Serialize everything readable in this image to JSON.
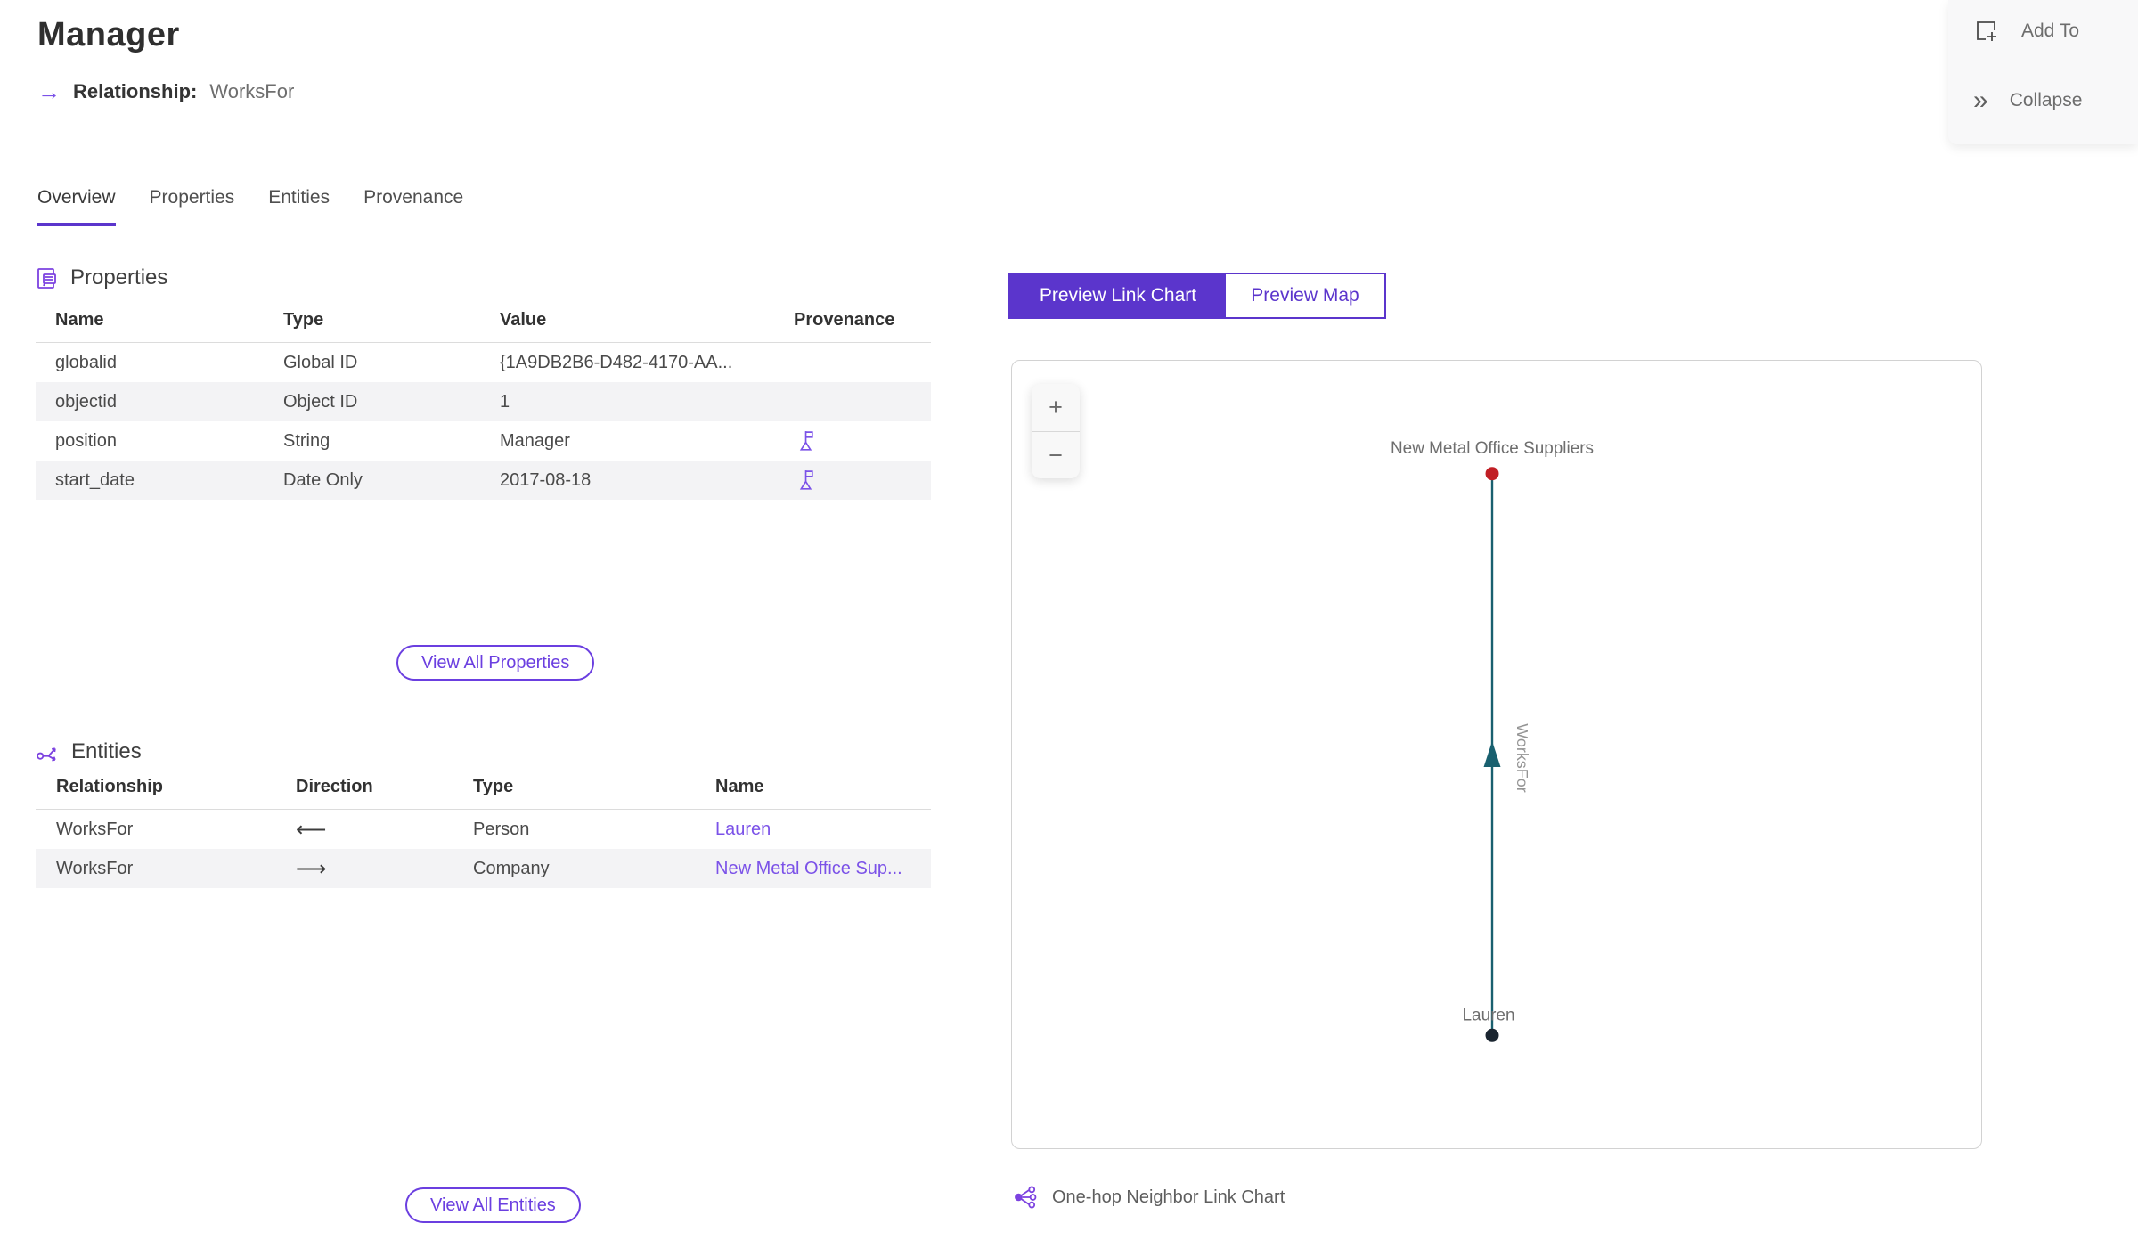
{
  "header": {
    "title": "Manager",
    "arrow_icon": "→",
    "relationship_label": "Relationship:",
    "relationship_value": "WorksFor"
  },
  "quick_actions": {
    "add_to": "Add To",
    "collapse": "Collapse",
    "collapse_icon": "»"
  },
  "tabs": [
    {
      "label": "Overview"
    },
    {
      "label": "Properties"
    },
    {
      "label": "Entities"
    },
    {
      "label": "Provenance"
    }
  ],
  "properties_section": {
    "title": "Properties",
    "columns": [
      "Name",
      "Type",
      "Value",
      "Provenance"
    ],
    "rows": [
      {
        "name": "globalid",
        "type": "Global ID",
        "value": "{1A9DB2B6-D482-4170-AA...",
        "provenance": false
      },
      {
        "name": "objectid",
        "type": "Object ID",
        "value": "1",
        "provenance": false
      },
      {
        "name": "position",
        "type": "String",
        "value": "Manager",
        "provenance": true
      },
      {
        "name": "start_date",
        "type": "Date Only",
        "value": "2017-08-18",
        "provenance": true
      }
    ],
    "view_all": "View All Properties"
  },
  "entities_section": {
    "title": "Entities",
    "columns": [
      "Relationship",
      "Direction",
      "Type",
      "Name"
    ],
    "rows": [
      {
        "relationship": "WorksFor",
        "direction": "⟵",
        "type": "Person",
        "name": "Lauren"
      },
      {
        "relationship": "WorksFor",
        "direction": "⟶",
        "type": "Company",
        "name": "New Metal Office Sup..."
      }
    ],
    "view_all": "View All Entities"
  },
  "preview": {
    "toggle": {
      "link_chart": "Preview Link Chart",
      "map": "Preview Map"
    },
    "zoom_in": "+",
    "zoom_out": "−",
    "caption": "One-hop Neighbor Link Chart"
  },
  "link_chart": {
    "nodes": [
      {
        "label": "New Metal Office Suppliers",
        "color": "#c11f25"
      },
      {
        "label": "Lauren",
        "color": "#1a2530"
      }
    ],
    "edge": {
      "label": "WorksFor",
      "color": "#19606f",
      "direction": "up"
    }
  },
  "colors": {
    "accent_purple": "#5b35cc",
    "link_purple": "#7b52e8",
    "icon_purple": "#7c42e0",
    "edge_teal": "#19606f",
    "node_red": "#c11f25",
    "node_dark": "#1a2530",
    "alt_row": "#f3f3f5"
  }
}
